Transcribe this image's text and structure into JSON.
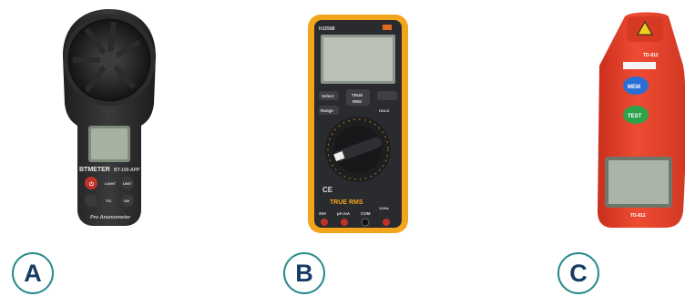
{
  "devices": [
    {
      "letter": "A",
      "brand": "BTMETER",
      "model": "BT-100-APP",
      "subtitle": "Pro Anemometer",
      "buttons": [
        "",
        "LIGHT",
        "UNIT",
        "",
        "T/C",
        "ON"
      ]
    },
    {
      "letter": "B",
      "model": "HJ2588",
      "buttons": {
        "select": "Select",
        "range": "Range",
        "hold": "HOLD",
        "true_rms_top": "TRUE",
        "true_rms_bottom": "RMS"
      },
      "brand_text": "TRUE RMS",
      "ports": [
        "20A",
        "µA mA",
        "COM",
        "VΩHz"
      ]
    },
    {
      "letter": "C",
      "model_top": "TD-812",
      "buttons": {
        "mem": "MEM",
        "test": "TEST"
      },
      "model_bottom": "TD-812"
    }
  ],
  "colors": {
    "badge_border": "#2a8a8c",
    "badge_text": "#173c63",
    "meter_b_frame": "#f2a51c",
    "meter_c_body": "#e8412c"
  }
}
